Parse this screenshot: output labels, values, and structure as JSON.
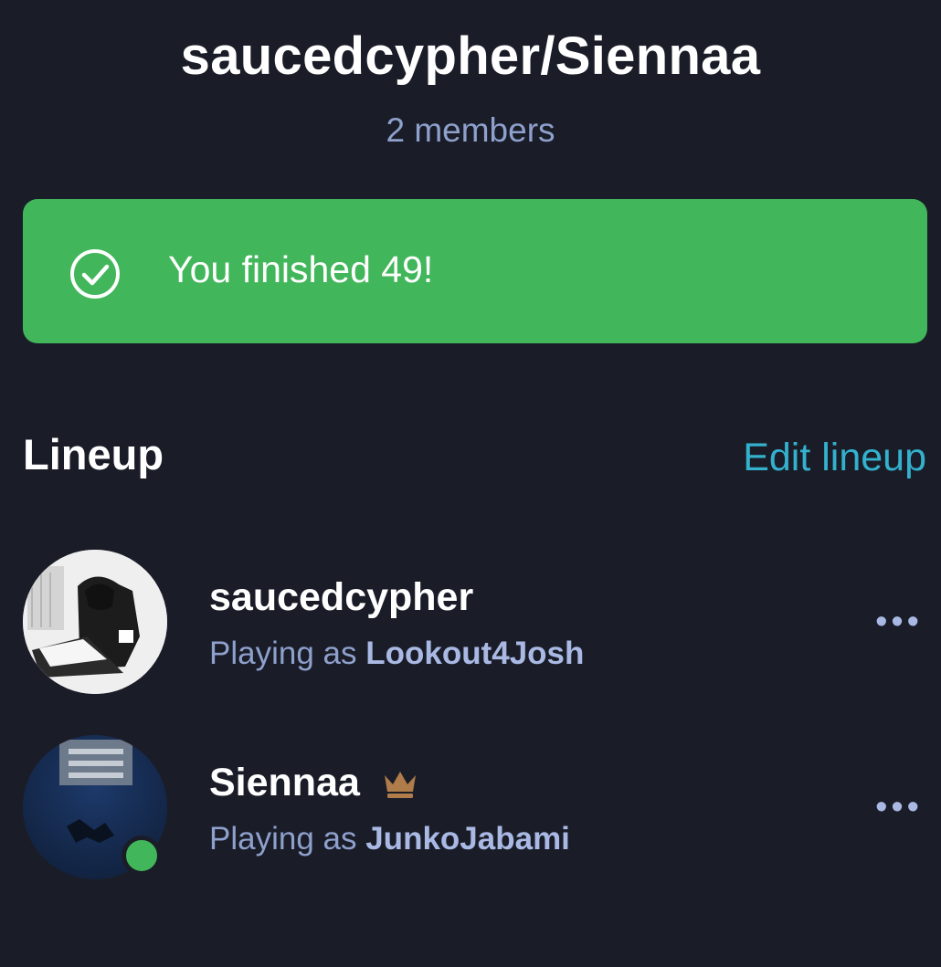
{
  "header": {
    "title": "saucedcypher/Siennaa",
    "members_count": "2 members"
  },
  "banner": {
    "text": "You finished 49!",
    "icon": "check-circle-icon",
    "color": "#42b65a"
  },
  "lineup": {
    "title": "Lineup",
    "edit_label": "Edit lineup",
    "members": [
      {
        "name": "saucedcypher",
        "playing_prefix": "Playing as ",
        "playing_as": "Lookout4Josh",
        "more_label": "•••",
        "online": false,
        "is_host": false
      },
      {
        "name": "Siennaa",
        "playing_prefix": "Playing as ",
        "playing_as": "JunkoJabami",
        "more_label": "•••",
        "online": true,
        "is_host": true
      }
    ]
  },
  "colors": {
    "background": "#1a1d28",
    "accent_link": "#33b1cd",
    "success": "#42b65a",
    "muted_text": "#8ea0cc",
    "crown": "#b07c4a"
  }
}
